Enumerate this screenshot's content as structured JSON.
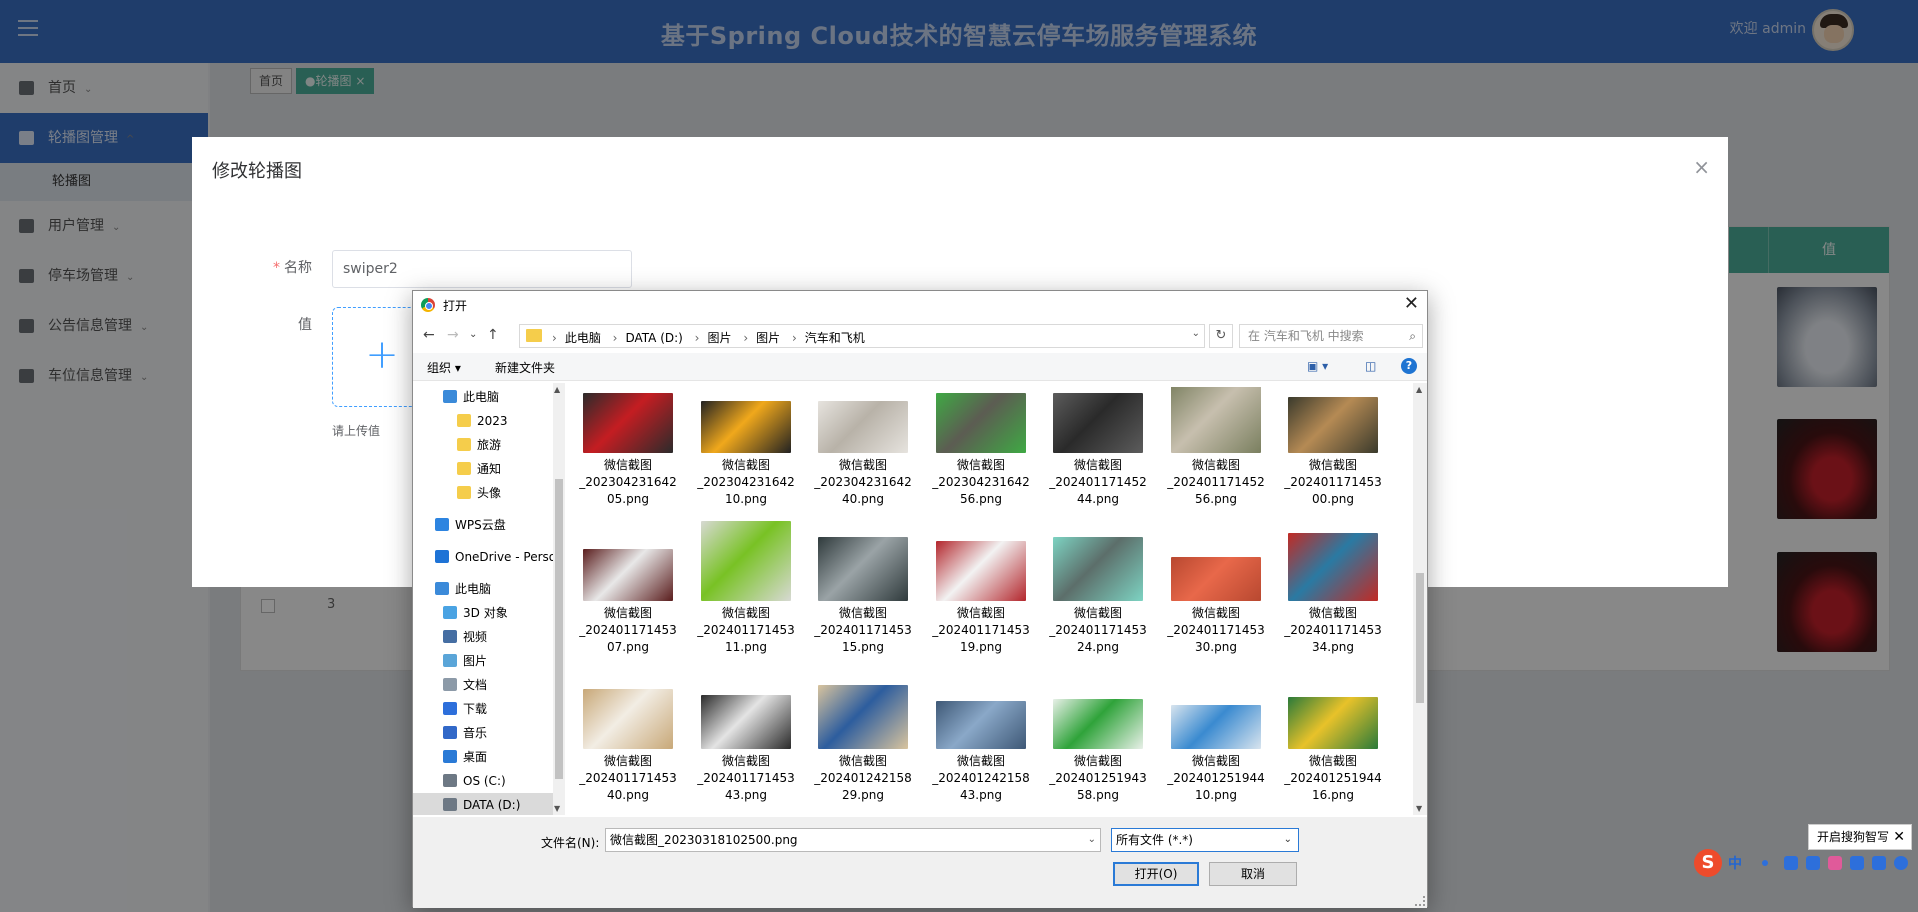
{
  "app": {
    "title": "基于Spring Cloud技术的智慧云停车场服务管理系统",
    "welcome": "欢迎 admin"
  },
  "sidebar": {
    "items": [
      {
        "label": "首页",
        "arrow": "⌄"
      },
      {
        "label": "轮播图管理",
        "arrow": "^"
      },
      {
        "label": "用户管理",
        "arrow": "⌄"
      },
      {
        "label": "停车场管理",
        "arrow": "⌄"
      },
      {
        "label": "公告信息管理",
        "arrow": "⌄"
      },
      {
        "label": "车位信息管理",
        "arrow": "⌄"
      }
    ],
    "sub_item": "轮播图"
  },
  "tabs": {
    "home": "首页",
    "active": "●轮播图",
    "close": "×"
  },
  "background_table": {
    "header_value": "值",
    "row_number": "3"
  },
  "edit_dialog": {
    "title": "修改轮播图",
    "close": "×",
    "name_label": "名称",
    "name_value": "swiper2",
    "value_label": "值",
    "upload_plus": "+",
    "upload_tip": "请上传值"
  },
  "file_dialog": {
    "title": "打开",
    "close": "✕",
    "nav": {
      "back": "←",
      "forward": "→",
      "recent": "⌄",
      "up": "↑",
      "refresh": "↻"
    },
    "breadcrumb": [
      "此电脑",
      "DATA (D:)",
      "图片",
      "图片",
      "汽车和飞机"
    ],
    "breadcrumb_sep": "›",
    "search_placeholder": "在 汽车和飞机 中搜索",
    "toolbar": {
      "organize": "组织 ▾",
      "new_folder": "新建文件夹",
      "view_icon": "▣ ▾",
      "pane_icon": "◫",
      "help": "?"
    },
    "tree": [
      {
        "label": "此电脑",
        "color": "#3b8ad9"
      },
      {
        "label": "2023",
        "color": "#f5cd4b"
      },
      {
        "label": "旅游",
        "color": "#f5cd4b"
      },
      {
        "label": "通知",
        "color": "#f5cd4b"
      },
      {
        "label": "头像",
        "color": "#f5cd4b"
      },
      {
        "label": "WPS云盘",
        "color": "#2d84e0"
      },
      {
        "label": "OneDrive - Personal",
        "color": "#1e73d6"
      },
      {
        "label": "此电脑",
        "color": "#3b8ad9"
      },
      {
        "label": "3D 对象",
        "color": "#4aa3e3"
      },
      {
        "label": "视频",
        "color": "#456ea3"
      },
      {
        "label": "图片",
        "color": "#5aa5d8"
      },
      {
        "label": "文档",
        "color": "#8c9aa8"
      },
      {
        "label": "下载",
        "color": "#2d6fdb"
      },
      {
        "label": "音乐",
        "color": "#3168c8"
      },
      {
        "label": "桌面",
        "color": "#2a7ad6"
      },
      {
        "label": "OS (C:)",
        "color": "#6d7884"
      },
      {
        "label": "DATA (D:)",
        "color": "#6d7884"
      }
    ],
    "files": [
      {
        "l1": "微信截图",
        "l2": "_202304231642",
        "l3": "05.png",
        "c1": "#c41d22",
        "c2": "#2b2b2b"
      },
      {
        "l1": "微信截图",
        "l2": "_202304231642",
        "l3": "10.png",
        "c1": "#f0a81c",
        "c2": "#222222"
      },
      {
        "l1": "微信截图",
        "l2": "_202304231642",
        "l3": "40.png",
        "c1": "#b8b2a8",
        "c2": "#e6e3de"
      },
      {
        "l1": "微信截图",
        "l2": "_202304231642",
        "l3": "56.png",
        "c1": "#5c5c52",
        "c2": "#3fa944"
      },
      {
        "l1": "微信截图",
        "l2": "_202401171452",
        "l3": "44.png",
        "c1": "#2a2a2a",
        "c2": "#5c5c5c"
      },
      {
        "l1": "微信截图",
        "l2": "_202401171452",
        "l3": "56.png",
        "c1": "#c7bfae",
        "c2": "#7a7f5f"
      },
      {
        "l1": "微信截图",
        "l2": "_202401171453",
        "l3": "00.png",
        "c1": "#b58a54",
        "c2": "#3a3a2c"
      },
      {
        "l1": "微信截图",
        "l2": "_202401171453",
        "l3": "07.png",
        "c1": "#e8e8e8",
        "c2": "#5a1d1d"
      },
      {
        "l1": "微信截图",
        "l2": "_202401171453",
        "l3": "11.png",
        "c1": "#78c224",
        "c2": "#d7d9d3"
      },
      {
        "l1": "微信截图",
        "l2": "_202401171453",
        "l3": "15.png",
        "c1": "#9aa3a6",
        "c2": "#2f3a3c"
      },
      {
        "l1": "微信截图",
        "l2": "_202401171453",
        "l3": "19.png",
        "c1": "#f2f2f2",
        "c2": "#b3262c"
      },
      {
        "l1": "微信截图",
        "l2": "_202401171453",
        "l3": "24.png",
        "c1": "#5c6e6a",
        "c2": "#7dd3c2"
      },
      {
        "l1": "微信截图",
        "l2": "_202401171453",
        "l3": "30.png",
        "c1": "#e8684a",
        "c2": "#b84830"
      },
      {
        "l1": "微信截图",
        "l2": "_202401171453",
        "l3": "34.png",
        "c1": "#2a7aa3",
        "c2": "#c22a24"
      },
      {
        "l1": "微信截图",
        "l2": "_202401171453",
        "l3": "40.png",
        "c1": "#f2ede4",
        "c2": "#c8a878"
      },
      {
        "l1": "微信截图",
        "l2": "_202401171453",
        "l3": "43.png",
        "c1": "#e4e4e4",
        "c2": "#2a2a2a"
      },
      {
        "l1": "微信截图",
        "l2": "_202401242158",
        "l3": "29.png",
        "c1": "#2d5d9e",
        "c2": "#d9c49e"
      },
      {
        "l1": "微信截图",
        "l2": "_202401242158",
        "l3": "43.png",
        "c1": "#8aa8c8",
        "c2": "#3e5876"
      },
      {
        "l1": "微信截图",
        "l2": "_202401251943",
        "l3": "58.png",
        "c1": "#2fa33a",
        "c2": "#e8f0e8"
      },
      {
        "l1": "微信截图",
        "l2": "_202401251944",
        "l3": "10.png",
        "c1": "#3a8ad0",
        "c2": "#d8e4ee"
      },
      {
        "l1": "微信截图",
        "l2": "_202401251944",
        "l3": "16.png",
        "c1": "#e8c22a",
        "c2": "#2a7a3a"
      }
    ],
    "filename_label": "文件名(N):",
    "filename_value": "微信截图_20230318102500.png",
    "filetype_value": "所有文件 (*.*)",
    "open_button": "打开(O)",
    "cancel_button": "取消"
  },
  "ime": {
    "tip": "开启搜狗智写",
    "tip_close": "✕",
    "logo": "S",
    "mode": "中"
  }
}
